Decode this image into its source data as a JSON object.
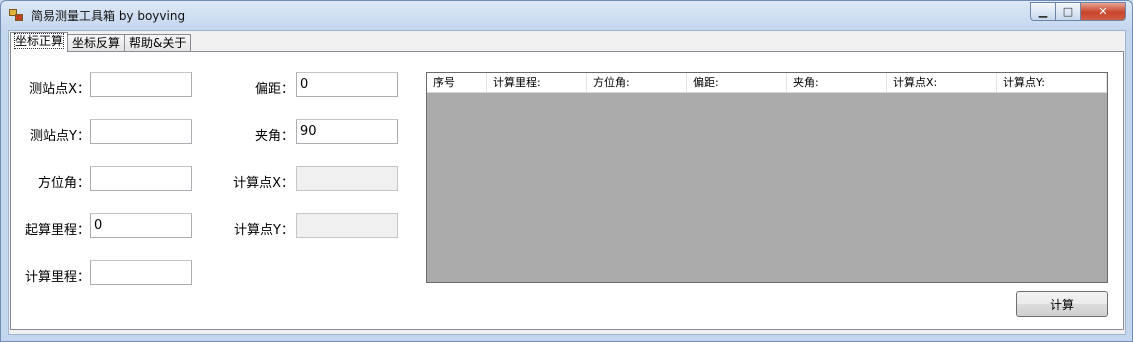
{
  "window": {
    "title": "简易测量工具箱 by boyving",
    "min_glyph": "▁",
    "max_glyph": "□",
    "close_glyph": "✕"
  },
  "tabs": [
    {
      "label": "坐标正算"
    },
    {
      "label": "坐标反算"
    },
    {
      "label": "帮助&关于"
    }
  ],
  "form": {
    "station_x": {
      "label": "测站点X：",
      "value": ""
    },
    "station_y": {
      "label": "测站点Y：",
      "value": ""
    },
    "azimuth": {
      "label": "方位角：",
      "value": ""
    },
    "start_mileage": {
      "label": "起算里程：",
      "value": "0"
    },
    "calc_mileage": {
      "label": "计算里程：",
      "value": ""
    },
    "offset": {
      "label": "偏距：",
      "value": "0"
    },
    "angle": {
      "label": "夹角：",
      "value": "90"
    },
    "calc_x": {
      "label": "计算点X：",
      "value": ""
    },
    "calc_y": {
      "label": "计算点Y：",
      "value": ""
    }
  },
  "grid": {
    "columns": [
      "序号",
      "计算里程:",
      "方位角:",
      "偏距:",
      "夹角:",
      "计算点X:",
      "计算点Y:"
    ]
  },
  "calc_button": {
    "label": "计算"
  }
}
